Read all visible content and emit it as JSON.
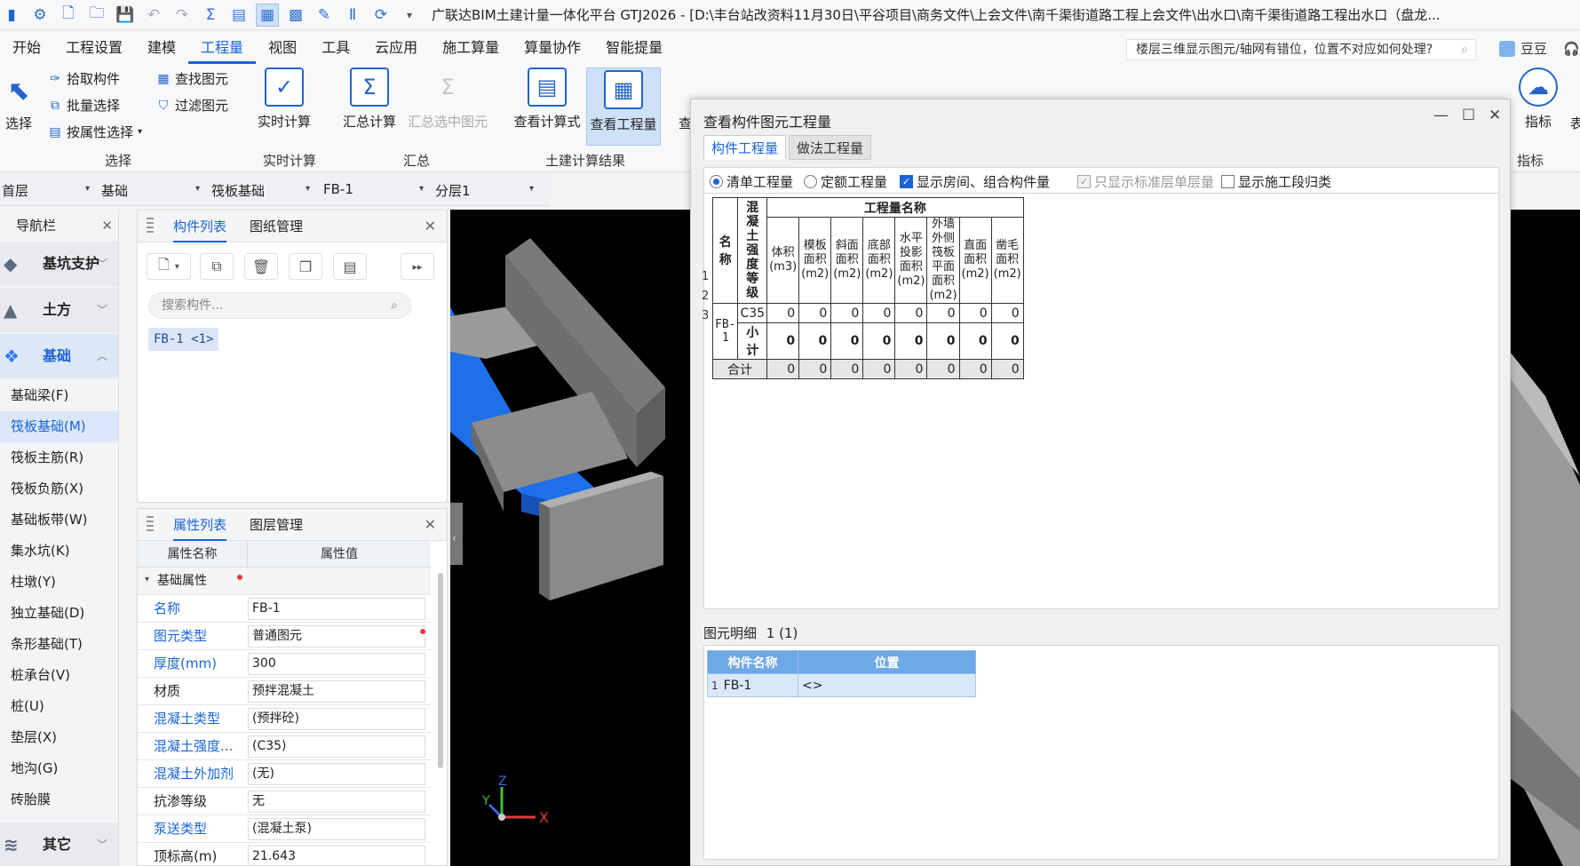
{
  "window": {
    "title": "广联达BIM土建计量一体化平台 GTJ2026 - [D:\\丰台站改资料11月30日\\平谷项目\\商务文件\\上会文件\\南千渠街道路工程上会文件\\出水口\\南千渠街道路工程出水口（盘龙..."
  },
  "menu": {
    "items": [
      "开始",
      "工程设置",
      "建模",
      "工程量",
      "视图",
      "工具",
      "云应用",
      "施工算量",
      "算量协作",
      "智能提量"
    ],
    "help_search": "楼层三维显示图元/轴网有错位，位置不对应如何处理?",
    "user": "豆豆"
  },
  "ribbon": {
    "select": {
      "big": "选择",
      "pick": "拾取构件",
      "batch": "批量选择",
      "by_attr": "按属性选择",
      "find": "查找图元",
      "filter": "过滤图元",
      "group": "选择"
    },
    "realtime": {
      "calc": "实时计算",
      "group": "实时计算"
    },
    "summary": {
      "calc": "汇总计算",
      "selected": "汇总选中图元",
      "group": "汇总"
    },
    "results": {
      "formula": "查看计算式",
      "quantity": "查看工程量",
      "partial": "查",
      "group": "土建计算结果"
    },
    "right": {
      "indicator": "指标",
      "group": "指标",
      "more": "表"
    }
  },
  "filter": {
    "floor": "首层",
    "type": "基础",
    "sub": "筏板基础",
    "comp": "FB-1",
    "layer": "分层1"
  },
  "nav": {
    "title": "导航栏",
    "categories": [
      {
        "label": "基坑支护"
      },
      {
        "label": "土方"
      },
      {
        "label": "基础"
      }
    ],
    "items": [
      "基础梁(F)",
      "筏板基础(M)",
      "筏板主筋(R)",
      "筏板负筋(X)",
      "基础板带(W)",
      "集水坑(K)",
      "柱墩(Y)",
      "独立基础(D)",
      "条形基础(T)",
      "桩承台(V)",
      "桩(U)",
      "垫层(X)",
      "地沟(G)",
      "砖胎膜"
    ],
    "selected": "筏板基础(M)",
    "bottom_category": "其它"
  },
  "component_panel": {
    "tab1": "构件列表",
    "tab2": "图纸管理",
    "search_placeholder": "搜索构件...",
    "item": "FB-1 <1>"
  },
  "property_panel": {
    "tab1": "属性列表",
    "tab2": "图层管理",
    "col_name": "属性名称",
    "col_value": "属性值",
    "group": "基础属性",
    "rows": [
      {
        "name": "名称",
        "value": "FB-1"
      },
      {
        "name": "图元类型",
        "value": "普通图元"
      },
      {
        "name": "厚度(mm)",
        "value": "300"
      },
      {
        "name": "材质",
        "value": "预拌混凝土"
      },
      {
        "name": "混凝土类型",
        "value": "(预拌砼)"
      },
      {
        "name": "混凝土强度...",
        "value": "(C35)"
      },
      {
        "name": "混凝土外加剂",
        "value": "(无)"
      },
      {
        "name": "抗渗等级",
        "value": "无"
      },
      {
        "name": "泵送类型",
        "value": "(混凝土泵)"
      },
      {
        "name": "顶标高(m)",
        "value": "21.643"
      }
    ]
  },
  "axes": {
    "x": "X",
    "y": "Y",
    "z": "Z"
  },
  "dialog": {
    "title": "查看构件图元工程量",
    "tab1": "构件工程量",
    "tab2": "做法工程量",
    "options": {
      "list_qty": "清单工程量",
      "quota_qty": "定额工程量",
      "show_room": "显示房间、组合构件量",
      "std_floor": "只显示标准层单层量",
      "stage": "显示施工段归类"
    },
    "table": {
      "h_name": "名称",
      "h_grade": "混凝土强度等级",
      "h_group": "工程量名称",
      "cols": [
        "体积(m3)",
        "模板面积(m2)",
        "斜面面积(m2)",
        "底部面积(m2)",
        "水平投影面积(m2)",
        "外墙外侧筏板平面面积(m2)",
        "直面面积(m2)",
        "凿毛面积(m2)"
      ],
      "row_labels": [
        "1",
        "2",
        "3"
      ],
      "name": "FB-1",
      "grade": "C35",
      "subtotal": "小计",
      "total": "合计",
      "values": {
        "c35": [
          "0",
          "0",
          "0",
          "0",
          "0",
          "0",
          "0",
          "0"
        ],
        "subtotal": [
          "0",
          "0",
          "0",
          "0",
          "0",
          "0",
          "0",
          "0"
        ],
        "total": [
          "0",
          "0",
          "0",
          "0",
          "0",
          "0",
          "0",
          "0"
        ]
      }
    },
    "detail": {
      "label": "图元明细",
      "count": "1 (1)",
      "h_name": "构件名称",
      "h_pos": "位置",
      "row_num": "1",
      "name": "FB-1",
      "pos": "<>"
    }
  }
}
